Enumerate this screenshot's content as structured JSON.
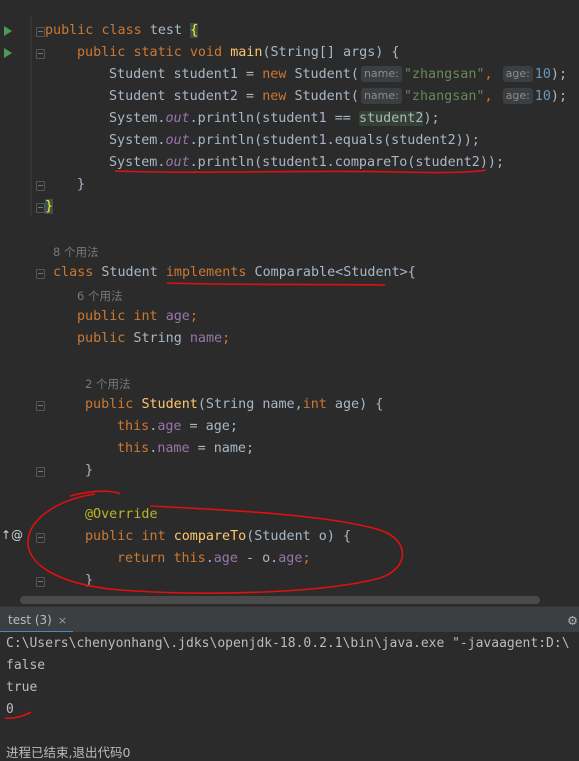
{
  "editor": {
    "usage_hints": {
      "student_class": "8 个用法",
      "age_field": "6 个用法",
      "constructor": "2 个用法"
    },
    "inlay": {
      "name": "name:",
      "age": "age:"
    },
    "tokens": {
      "public": "public",
      "class": "class",
      "static": "static",
      "void": "void",
      "new": "new",
      "int": "int",
      "this": "this",
      "return": "return",
      "implements": "implements",
      "test": "test",
      "main": "main",
      "string_args": "(String[] args) {",
      "student": "Student",
      "student1_decl": " student1 = ",
      "student2_decl": " student2 = ",
      "zhangsan": "\"zhangsan\"",
      "ten": "10",
      "system": "System.",
      "out": "out",
      "println_eq": ".println(student1 == ",
      "student2": "student2",
      "close_semi": ");",
      "println_equals": ".println(student1.equals(student2));",
      "println_compare": ".println(student1.compareTo(student2));",
      "open_brace": "{",
      "close_brace": "}",
      "comparable": " Comparable<Student>{",
      "age": "age",
      "name": "name",
      "semi": ";",
      "string_type": " String ",
      "ctor_params_a": "(String name,",
      "ctor_params_b": " age) {",
      "dot": ".",
      "assign_age": " = age;",
      "assign_name": " = name;",
      "override": "@Override",
      "compareTo": "compareTo",
      "compare_params": "(Student o) {",
      "minus_o": " - o.",
      "comma": ", ",
      "paren_open": "("
    }
  },
  "run_tab": {
    "label": "test (3)",
    "close": "×"
  },
  "console": {
    "command": "C:\\Users\\chenyonhang\\.jdks\\openjdk-18.0.2.1\\bin\\java.exe \"-javaagent:D:\\",
    "out1": "false",
    "out2": "true",
    "out3": "0",
    "exit": "进程已结束,退出代码0"
  },
  "colors": {
    "background": "#2b2b2b",
    "keyword": "#cc7832",
    "method": "#ffc66d",
    "string": "#6a8759",
    "number": "#6897bb",
    "field": "#9876aa",
    "annotation": "#bbb529",
    "red_marks": "#e01010"
  }
}
